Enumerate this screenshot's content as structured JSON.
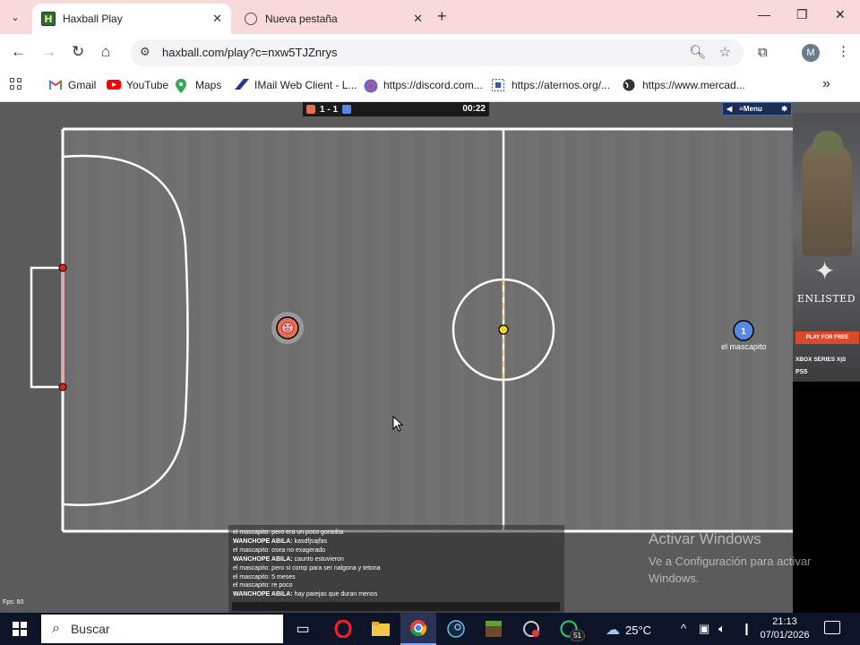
{
  "browser": {
    "tabs": [
      {
        "title": "Haxball Play",
        "active": true,
        "favicon": "haxball-icon"
      },
      {
        "title": "Nueva pestaña",
        "active": false,
        "favicon": "globe-icon"
      }
    ],
    "url": "haxball.com/play?c=nxw5TJZnrys",
    "profile_initial": "M",
    "bookmarks": [
      {
        "label": "Gmail",
        "icon": "gmail-icon",
        "color": "#ea4335"
      },
      {
        "label": "YouTube",
        "icon": "youtube-icon",
        "color": "#ff0000"
      },
      {
        "label": "Maps",
        "icon": "maps-icon",
        "color": "#34a853"
      },
      {
        "label": "IMail Web Client - L...",
        "icon": "imail-icon",
        "color": "#1a3a8f"
      },
      {
        "label": "https://discord.com...",
        "icon": "discord-icon",
        "color": "#5865f2"
      },
      {
        "label": "https://aternos.org/...",
        "icon": "aternos-icon",
        "color": "#2d5db3"
      },
      {
        "label": "https://www.mercad...",
        "icon": "globe-icon",
        "color": "#333333"
      }
    ]
  },
  "game": {
    "score": "1 - 1",
    "time": "00:22",
    "menu_label": "≡Menu",
    "red_player_avatar": "pig-icon",
    "blue_player_number": "1",
    "blue_player_name": "el mascapito",
    "fps": "Fps: 60",
    "team_colors": {
      "red": "#e56e56",
      "blue": "#5689e5"
    },
    "chat": [
      {
        "name": "",
        "text": "el mascapito: pero era un poco goradita"
      },
      {
        "name": "WANCHOPE ABILA:",
        "text": " kasdfjsajfas"
      },
      {
        "name": "",
        "text": "el mascapito: osea no exagerado"
      },
      {
        "name": "WANCHOPE ABILA:",
        "text": " caunto estuvieron"
      },
      {
        "name": "",
        "text": "el mascapito: pero si comp para ser nalgona y tetona"
      },
      {
        "name": "",
        "text": "el mascapito: 5 meses"
      },
      {
        "name": "",
        "text": "el mascapito: re poco"
      },
      {
        "name": "WANCHOPE ABILA:",
        "text": " hay parejas que duran menos"
      }
    ]
  },
  "ad": {
    "brand": "ENLISTED",
    "cta": "PLAY FOR FREE",
    "platform1": "XBOX SERIES X|S",
    "platform2": "PS5"
  },
  "watermark": {
    "title": "Activar Windows",
    "subtitle": "Ve a Configuración para activar Windows."
  },
  "taskbar": {
    "search_placeholder": "Buscar",
    "temperature": "25°C",
    "time": "21:13",
    "date": "07/01/2026",
    "whatsapp_badge": "51"
  }
}
